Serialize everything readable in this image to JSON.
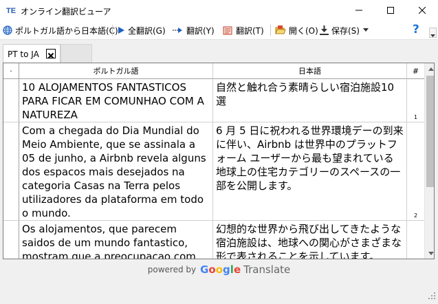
{
  "window": {
    "title": "オンライン翻訳ビューア",
    "app_icon_text": "TE"
  },
  "toolbar": {
    "lang_pair_label": "ポルトガル語から日本語(C)",
    "translate_all_label": "全翻訳(G)",
    "translate_y_label": "翻訳(Y)",
    "translate_t_label": "翻訳(T)",
    "open_label": "開く(O)",
    "save_label": "保存(S)",
    "help_label": "?"
  },
  "tabs": [
    {
      "label": "PT to JA",
      "active": true
    },
    {
      "label": "",
      "active": false
    }
  ],
  "grid": {
    "columns": {
      "marker": "·",
      "source": "ポルトガル語",
      "target": "日本語",
      "number": "#"
    },
    "rows": [
      {
        "source": "10 ALOJAMENTOS FANTASTICOS PARA FICAR EM COMUNHAO COM A NATUREZA",
        "target": "自然と触れ合う素晴らしい宿泊施設10選",
        "number": "1"
      },
      {
        "source": "Com a chegada do Dia Mundial do Meio Ambiente, que se assinala a 05 de junho, a Airbnb revela alguns dos espacos mais desejados na categoria Casas na Terra pelos utilizadores da plataforma em todo o mundo.",
        "target": "6 月 5 日に祝われる世界環境デーの到来に伴い、Airbnb は世界中のプラットフォーム ユーザーから最も望まれている地球上の住宅カテゴリーのスペースの一部を公開します。",
        "number": "2"
      },
      {
        "source": "Os alojamentos, que parecem saidos de um mundo fantastico, mostram que a preocupacao com",
        "target": "幻想的な世界から飛び出してきたような宿泊施設は、地球への関心がさまざまな形で表されることを示しています。",
        "number": ""
      }
    ]
  },
  "footer": {
    "powered_by": "powered by",
    "google": [
      "G",
      "o",
      "o",
      "g",
      "l",
      "e"
    ],
    "translate": "Translate"
  },
  "colors": {
    "google_blue": "#4285F4",
    "google_red": "#EA4335",
    "google_yellow": "#FBBC05",
    "google_green": "#34A853",
    "accent_blue": "#1e73d8"
  }
}
